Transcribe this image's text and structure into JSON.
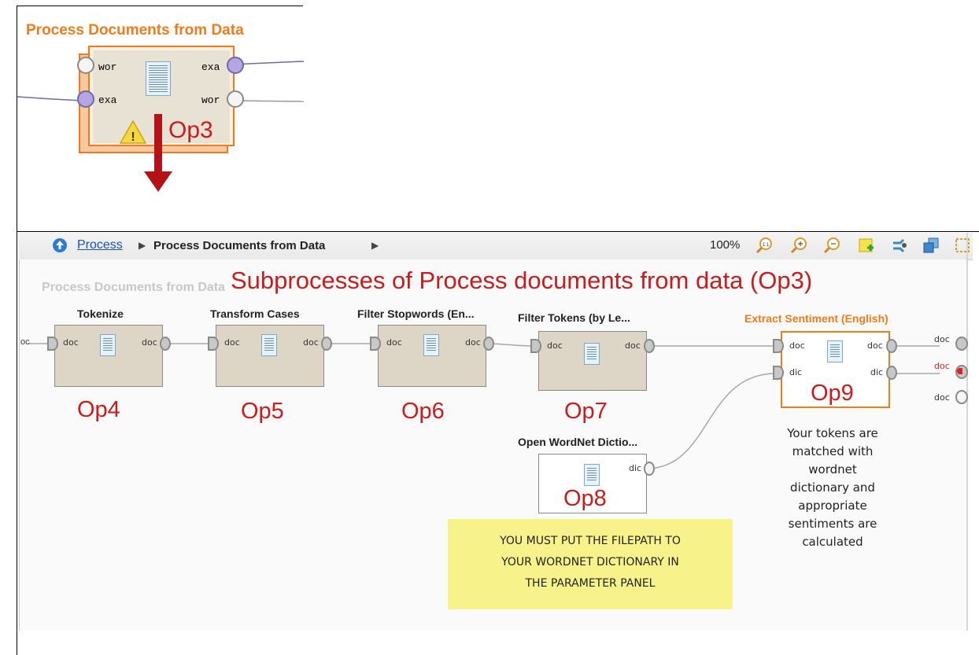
{
  "top_panel": {
    "operator_title": "Process Documents from Data",
    "ports": {
      "in_top": "wor",
      "in_bottom": "exa",
      "out_top": "exa",
      "out_bottom": "wor"
    },
    "op_label": "Op3"
  },
  "toolbar": {
    "breadcrumb_root": "Process",
    "breadcrumb_separator": "▶",
    "breadcrumb_current": "Process Documents from Data",
    "zoom": "100%"
  },
  "canvas": {
    "watermark": "Process Documents from Data",
    "heading": "Subprocesses of Process documents from data (Op3)",
    "left_edge_port": "oc",
    "operators": [
      {
        "title": "Tokenize",
        "in": "doc",
        "out": "doc",
        "label": "Op4"
      },
      {
        "title": "Transform Cases",
        "in": "doc",
        "out": "doc",
        "label": "Op5"
      },
      {
        "title": "Filter Stopwords (En...",
        "in": "doc",
        "out": "doc",
        "label": "Op6"
      },
      {
        "title": "Filter Tokens (by Le...",
        "in": "doc",
        "out": "doc",
        "label": "Op7"
      },
      {
        "title": "Open WordNet Dictio...",
        "out": "dic",
        "label": "Op8"
      },
      {
        "title": "Extract Sentiment (English)",
        "in_top": "doc",
        "in_bottom": "dic",
        "out_top": "doc",
        "out_bottom": "dic",
        "label": "Op9"
      }
    ],
    "output_ports": [
      "doc",
      "doc",
      "doc"
    ],
    "note": "YOU MUST PUT THE FILEPATH TO\nYOUR WORDNET DICTIONARY IN\nTHE PARAMETER PANEL",
    "description": "Your tokens are\nmatched with\nwordnet\ndictionary and\nappropriate\nsentiments are\ncalculated"
  },
  "colors": {
    "accent_orange": "#f07b1a",
    "label_red": "#cc1b1b",
    "note_yellow": "#f8f28a",
    "link_blue": "#1a4fbf"
  }
}
